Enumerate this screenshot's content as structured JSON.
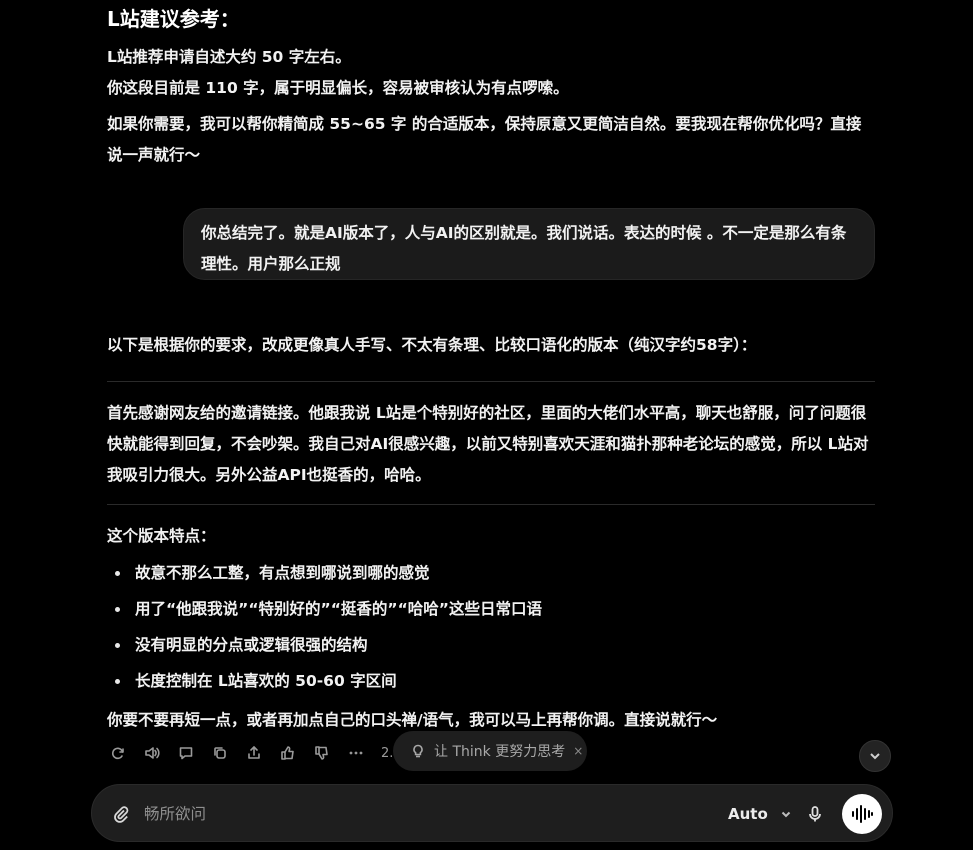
{
  "heading": "L站建议参考：",
  "intro": {
    "line1": "L站推荐申请自述大约 50 字左右。",
    "line2": "你这段目前是 110 字，属于明显偏长，容易被审核认为有点啰嗦。",
    "line3": "如果你需要，我可以帮你精简成 55~65 字 的合适版本，保持原意又更简洁自然。要我现在帮你优化吗？直接说一声就行～"
  },
  "user_message": "你总结完了。就是AI版本了，人与AI的区别就是。我们说话。表达的时候 。不一定是那么有条理性。用户那么正规",
  "response": {
    "lead": "以下是根据你的要求，改成更像真人手写、不太有条理、比较口语化的版本（纯汉字约58字）：",
    "quote": "首先感谢网友给的邀请链接。他跟我说 L站是个特别好的社区，里面的大佬们水平高，聊天也舒服，问了问题很快就能得到回复，不会吵架。我自己对AI很感兴趣，以前又特别喜欢天涯和猫扑那种老论坛的感觉，所以 L站对我吸引力很大。另外公益API也挺香的，哈哈。",
    "features_title": "这个版本特点：",
    "features": [
      "故意不那么工整，有点想到哪说到哪的感觉",
      "用了“他跟我说”“特别好的”“挺香的”“哈哈”这些日常口语",
      "没有明显的分点或逻辑很强的结构",
      "长度控制在 L站喜欢的 50-60 字区间"
    ],
    "closing": "你要不要再短一点，或者再加点自己的口头禅/语气，我可以马上再帮你调。直接说就行～"
  },
  "actions": {
    "icons": [
      "regenerate-icon",
      "speaker-icon",
      "comment-icon",
      "copy-icon",
      "share-icon",
      "thumbs-up-icon",
      "thumbs-down-icon",
      "more-icon"
    ],
    "stat_text": "2.6"
  },
  "think_chip": {
    "label": "让 Think 更努力思考",
    "close": "×"
  },
  "composer": {
    "placeholder": "畅所欲问",
    "model": "Auto"
  },
  "colors": {
    "background": "#000000",
    "bubble": "#1b1b1b",
    "composer": "#1e1e1e",
    "text": "#f2f2f2",
    "muted": "#9a9a9a"
  }
}
